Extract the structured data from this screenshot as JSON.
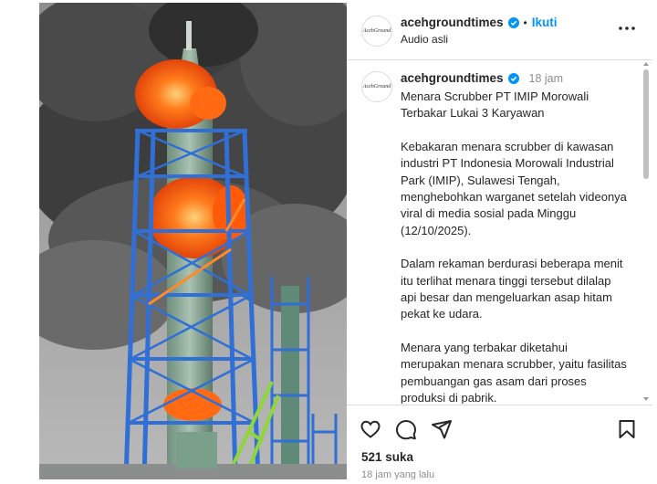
{
  "post": {
    "username": "acehgroundtimes",
    "follow_label": "Ikuti",
    "separator": "•",
    "audio": "Audio asli",
    "avatar_text": "AcehGround"
  },
  "caption": {
    "username": "acehgroundtimes",
    "time": "18 jam",
    "paragraphs": [
      "Menara Scrubber PT IMIP Morowali Terbakar Lukai 3 Karyawan",
      "Kebakaran menara scrubber di kawasan industri PT Indonesia Morowali Industrial Park (IMIP), Sulawesi Tengah, menghebohkan warganet setelah videonya viral di media sosial pada Minggu (12/10/2025).",
      "Dalam rekaman berdurasi beberapa menit itu terlihat menara tinggi tersebut dilalap api besar dan mengeluarkan asap hitam pekat ke udara.",
      "Menara yang terbakar diketahui merupakan menara scrubber, yaitu fasilitas pembuangan gas asam dari proses produksi di pabrik."
    ]
  },
  "engagement": {
    "likes": "521 suka",
    "posted": "18 jam yang lalu"
  },
  "icons": {
    "like": "heart-icon",
    "comment": "comment-icon",
    "share": "share-icon",
    "save": "bookmark-icon",
    "more": "more-icon",
    "verified": "verified-badge-icon"
  },
  "colors": {
    "accent": "#0095f6",
    "text": "#262626",
    "muted": "#8e8e8e",
    "border": "#dbdbdb"
  }
}
